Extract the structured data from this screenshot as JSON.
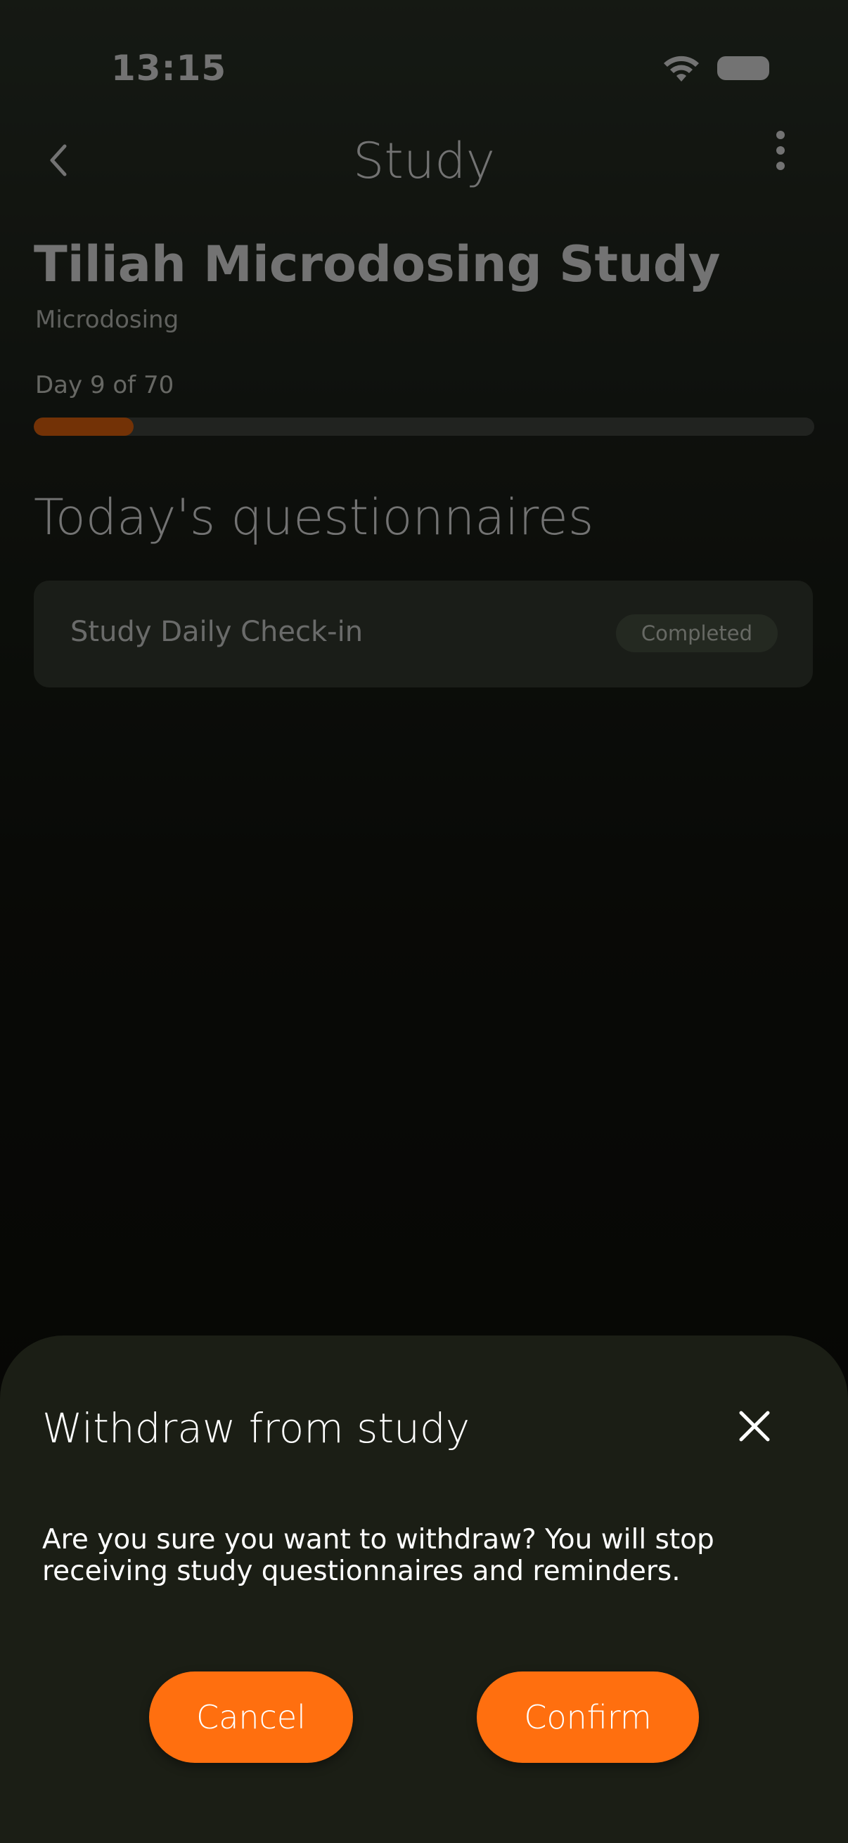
{
  "status_bar": {
    "time": "13:15",
    "icons": [
      "wifi-icon",
      "battery-icon"
    ]
  },
  "nav": {
    "title": "Study",
    "back_icon": "chevron-left-icon",
    "more_icon": "more-vertical-icon"
  },
  "study": {
    "title": "Tiliah Microdosing Study",
    "category": "Microdosing",
    "day_label": "Day 9 of 70",
    "current_day": 9,
    "total_days": 70,
    "progress_fraction": 0.128
  },
  "questionnaires": {
    "section_title": "Today's questionnaires",
    "items": [
      {
        "name": "Study Daily Check-in",
        "status": "Completed"
      }
    ]
  },
  "dialog": {
    "title": "Withdraw from study",
    "message": "Are you sure you want to withdraw? You will stop receiving study questionnaires and reminders.",
    "cancel_label": "Cancel",
    "confirm_label": "Confirm",
    "close_icon": "close-icon"
  },
  "colors": {
    "accent": "#ff6f0f",
    "sheet_background": "#1b1e15",
    "card_background": "#3b4136",
    "badge_background": "#505b4b"
  }
}
